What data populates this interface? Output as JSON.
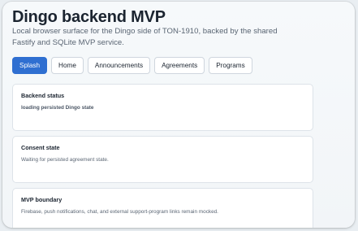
{
  "header": {
    "title": "Dingo backend MVP",
    "subtitle": "Local browser surface for the Dingo side of TON-1910, backed by the shared Fastify and SQLite MVP service."
  },
  "tabs": [
    {
      "label": "Splash",
      "active": true
    },
    {
      "label": "Home",
      "active": false
    },
    {
      "label": "Announcements",
      "active": false
    },
    {
      "label": "Agreements",
      "active": false
    },
    {
      "label": "Programs",
      "active": false
    }
  ],
  "cards": [
    {
      "title": "Backend status",
      "body": "loading persisted Dingo state"
    },
    {
      "title": "Consent state",
      "body": "Waiting for persisted agreement state."
    },
    {
      "title": "MVP boundary",
      "body": "Firebase, push notifications, chat, and external support-program links remain mocked."
    }
  ],
  "colors": {
    "accent": "#2f6fd1",
    "background": "#f4f7f9",
    "card": "#ffffff"
  }
}
